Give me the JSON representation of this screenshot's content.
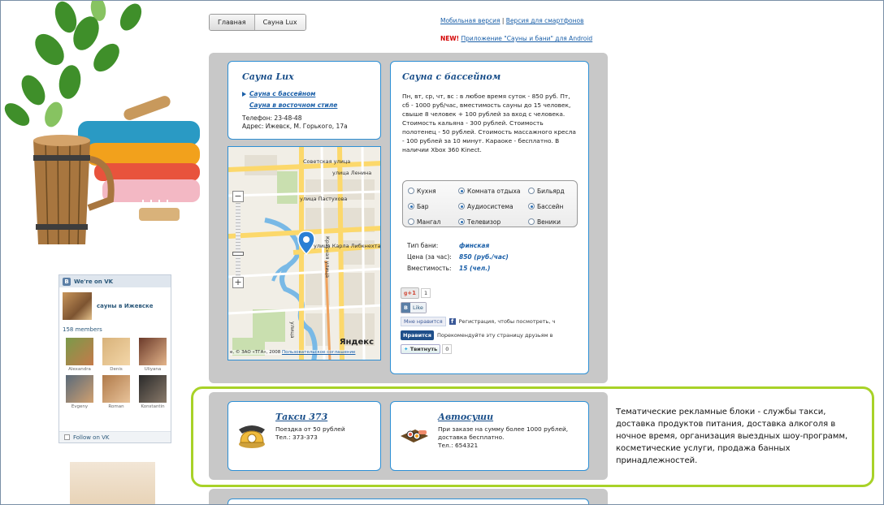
{
  "nav": {
    "tabs": [
      "Главная",
      "Сауна Lux"
    ],
    "mobile_link": "Мобильная версия",
    "separator": "|",
    "smartphone_link": "Версия для смартфонов",
    "new_label": "NEW!",
    "android_link": "Приложение \"Сауны и бани\" для Android"
  },
  "sauna": {
    "title": "Сауна Lux",
    "links": [
      "Сауна с бассейном",
      "Сауна в восточном стиле"
    ],
    "phone": "Телефон: 23-48-48",
    "address": "Адрес: Ижевск, М. Горького, 17а"
  },
  "map": {
    "streets": [
      "Советская улица",
      "улица Ленина",
      "улица Пастухова",
      "улица Карла Либкнехта",
      "Красная улица",
      "улица"
    ],
    "zoom_in": "+",
    "zoom_out": "−",
    "copyright": "e, © ЗАО «ТГА», 2008",
    "terms": "Пользовательское соглашение",
    "brand": "Яндекс"
  },
  "details": {
    "title": "Сауна с бассейном",
    "description": "Пн, вт, ср, чт, вс : в любое время суток - 850 руб. Пт, сб - 1000 руб/час, вместимость сауны до 15 человек, свыше 8 человек + 100 рублей за вход с человека. Стоимость кальяна - 300 рублей. Стоимость полотенец - 50 рублей. Стоимость массажного кресла - 100 рублей за 10 минут. Караоке - бесплатно. В наличии Xbox 360 Kinect.",
    "features": [
      {
        "label": "Кухня",
        "checked": false
      },
      {
        "label": "Комната отдыха",
        "checked": true
      },
      {
        "label": "Бильярд",
        "checked": false
      },
      {
        "label": "Бар",
        "checked": true
      },
      {
        "label": "Аудиосистема",
        "checked": true
      },
      {
        "label": "Бассейн",
        "checked": true
      },
      {
        "label": "Мангал",
        "checked": false
      },
      {
        "label": "Телевизор",
        "checked": true
      },
      {
        "label": "Веники",
        "checked": false
      }
    ],
    "specs": [
      {
        "label": "Тип бани:",
        "value": "финская"
      },
      {
        "label": "Цена (за час):",
        "value": "850 (руб./час)"
      },
      {
        "label": "Вместимость:",
        "value": "15 (чел.)"
      }
    ]
  },
  "social": {
    "gplus": "+1",
    "gplus_count": "1",
    "vk_b": "В",
    "vk_like": "Like",
    "fb_like": "Мне нравится",
    "fb_text": "Регистрация, чтобы посмотреть, ч",
    "ok_btn": "Нравится",
    "ok_text": "Порекомендуйте эту страницу друзьям в",
    "tweet": "Твитнуть",
    "tweet_count": "0"
  },
  "ads": [
    {
      "title": "Такси 373",
      "text": "Поездка от 50 рублей",
      "text2": "Тел.: 373-373"
    },
    {
      "title": "Автосуши",
      "text": "При заказе на сумму более 1000 рублей, доставка бесплатно.",
      "text2": "Тел.: 654321"
    }
  ],
  "annotation": "Тематические рекламные блоки - службы такси, доставка продуктов питания, доставка алкоголя в ночное время, организация выездных шоу-программ, косметические услуги, продажа банных принадлежностей.",
  "vk": {
    "header": "We're on VK",
    "group_name": "сауны в Ижевске",
    "members": "158 members",
    "people": [
      "Alexandra",
      "Denis",
      "Uliyana",
      "Evgeny",
      "Roman",
      "Konstantin"
    ],
    "follow": "Follow on VK"
  },
  "colors": {
    "accent": "#2d8fd5",
    "highlight": "#a8d228",
    "panel": "#c8c8c8",
    "link": "#1a5fa8",
    "new": "#d40000"
  }
}
